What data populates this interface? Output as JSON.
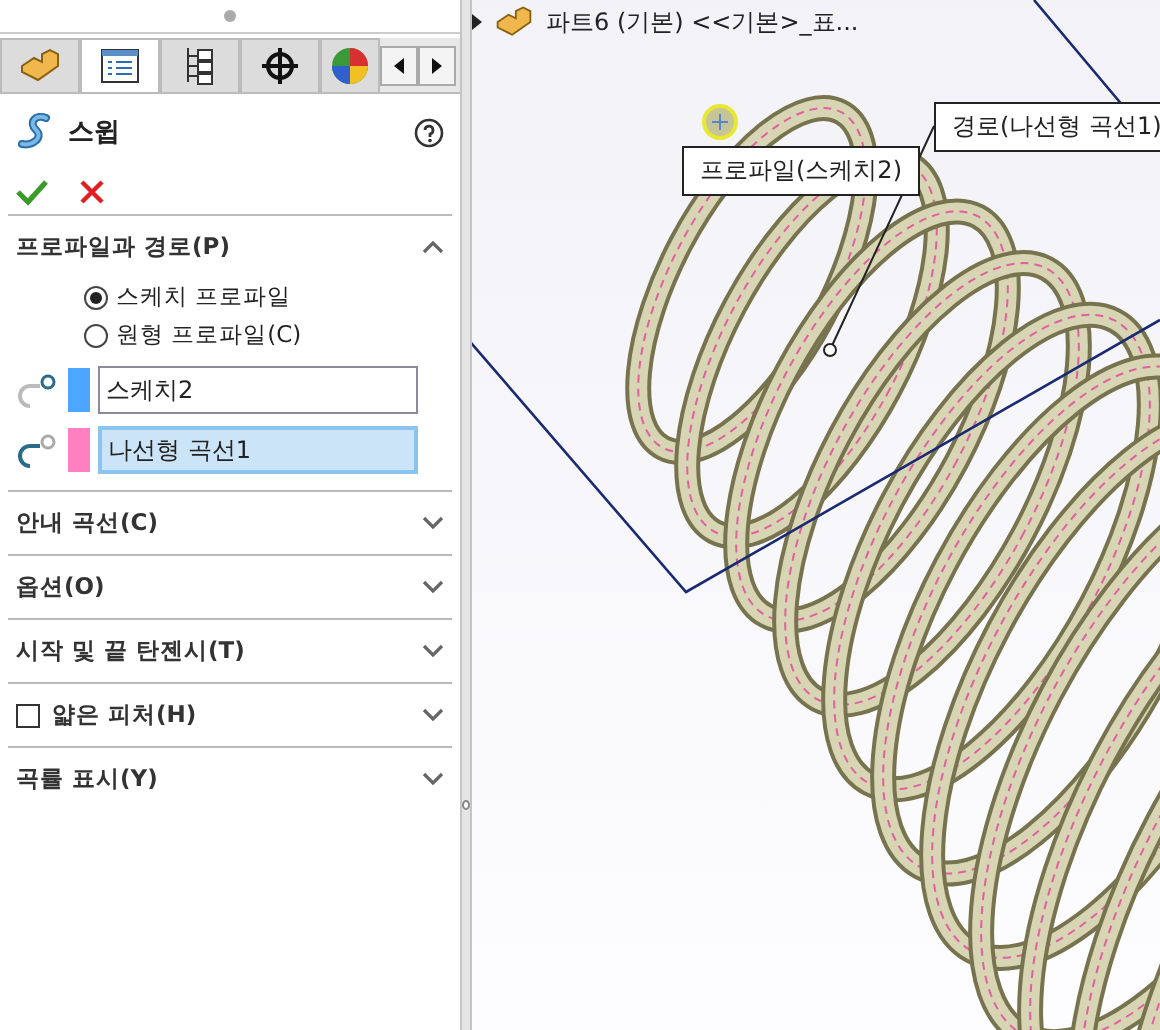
{
  "tabs": [
    {
      "selected": false
    },
    {
      "selected": true
    },
    {
      "selected": false
    },
    {
      "selected": false
    },
    {
      "selected": false
    }
  ],
  "feature": {
    "title": "스윕"
  },
  "profile_section": {
    "title": "프로파일과 경로(P)",
    "expanded": true,
    "radios": [
      {
        "label": "스케치 프로파일",
        "selected": true
      },
      {
        "label": "원형 프로파일(C)",
        "selected": false
      }
    ],
    "selections": [
      {
        "value": "스케치2",
        "color": "#4da6ff",
        "active": false
      },
      {
        "value": "나선형 곡선1",
        "color": "#ff80c0",
        "active": true
      }
    ]
  },
  "sections": [
    {
      "title": "안내 곡선(C)",
      "expanded": false,
      "kind": "plain"
    },
    {
      "title": "옵션(O)",
      "expanded": false,
      "kind": "plain"
    },
    {
      "title": "시작 및 끝 탄젠시(T)",
      "expanded": false,
      "kind": "plain"
    },
    {
      "title": "얇은 피처(H)",
      "expanded": false,
      "kind": "checkbox",
      "checked": false
    },
    {
      "title": "곡률 표시(Y)",
      "expanded": false,
      "kind": "plain"
    }
  ],
  "viewport": {
    "tree_item": "파트6 (기본) <<기본>_표...",
    "callouts": [
      {
        "kind": "profile",
        "label": "프로파일(스케치2)"
      },
      {
        "kind": "path",
        "label": "경로(나선형 곡선1)"
      }
    ]
  }
}
